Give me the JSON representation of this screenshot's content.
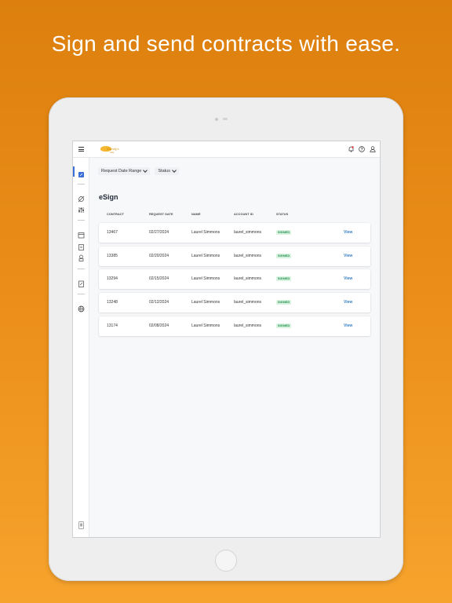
{
  "headline": "Sign and send contracts with ease.",
  "app": {
    "logo_text": "Brandy's",
    "logo_sub": "Cafe"
  },
  "filters": {
    "date_range_label": "Request Date Range",
    "status_label": "Status"
  },
  "page_title": "eSign",
  "table": {
    "columns": [
      "CONTRACT",
      "REQUEST DATE",
      "NAME",
      "ACCOUNT ID",
      "STATUS"
    ],
    "rows": [
      {
        "contract": "13467",
        "request_date": "02/27/2024",
        "name": "Laurel Simmons",
        "account_id": "laurel_simmons",
        "status": "SIGNED",
        "action": "View"
      },
      {
        "contract": "13385",
        "request_date": "02/20/2024",
        "name": "Laurel Simmons",
        "account_id": "laurel_simmons",
        "status": "SIGNED",
        "action": "View"
      },
      {
        "contract": "13294",
        "request_date": "02/15/2024",
        "name": "Laurel Simmons",
        "account_id": "laurel_simmons",
        "status": "SIGNED",
        "action": "View"
      },
      {
        "contract": "13248",
        "request_date": "02/12/2024",
        "name": "Laurel Simmons",
        "account_id": "laurel_simmons",
        "status": "SIGNED",
        "action": "View"
      },
      {
        "contract": "13174",
        "request_date": "02/08/2024",
        "name": "Laurel Simmons",
        "account_id": "laurel_simmons",
        "status": "SIGNED",
        "action": "View"
      }
    ]
  },
  "colors": {
    "background_top": "#dc7f0e",
    "background_bottom": "#f6a32c",
    "accent": "#3b6fd8",
    "signed_badge_bg": "#d7f3e0",
    "signed_badge_text": "#1e8a47",
    "link": "#3b82c4"
  },
  "icons": {
    "topbar": [
      "menu-icon",
      "notification-bell-icon",
      "help-icon",
      "user-account-icon"
    ],
    "sidebar": [
      "esign-icon",
      "analytics-icon",
      "sliders-icon",
      "calendar-icon",
      "clipboard-icon",
      "badge-icon",
      "document-icon",
      "globe-icon",
      "mobile-device-icon"
    ]
  }
}
